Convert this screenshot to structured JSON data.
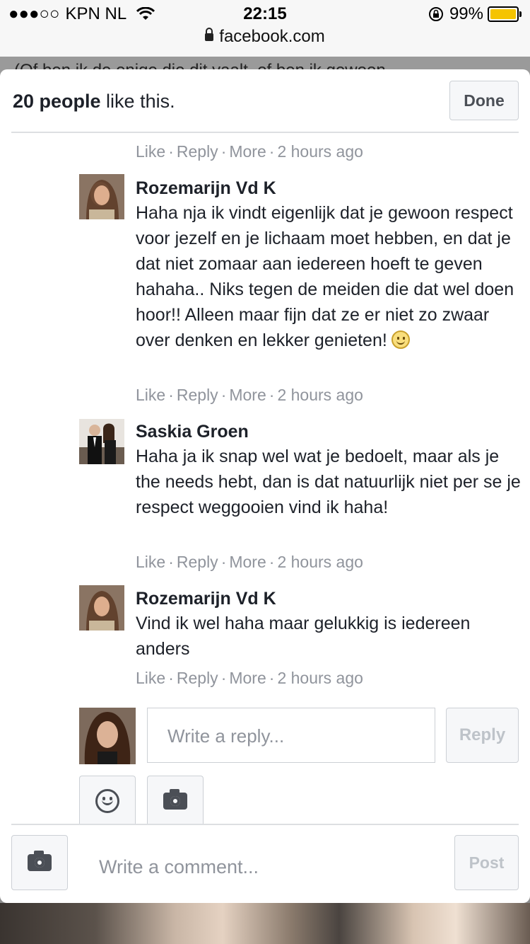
{
  "status_bar": {
    "signal": "●●●○○",
    "carrier": "KPN NL",
    "time": "22:15",
    "battery_percent": "99%",
    "battery_level": 0.99,
    "battery_color": "#f5c400"
  },
  "url_bar": {
    "domain": "facebook.com"
  },
  "background_text": "(Of ben ik de enige die dit vaalt, of ben ik gewoon",
  "header": {
    "likes_count": "20 people",
    "likes_suffix": " like this.",
    "done_label": "Done"
  },
  "top_meta": {
    "like": "Like",
    "reply": "Reply",
    "more": "More",
    "time": "2 hours ago"
  },
  "comments": [
    {
      "author": "Rozemarijn Vd K",
      "text": "Haha nja ik vindt eigenlijk dat je gewoon respect voor jezelf en je lichaam moet hebben, en dat je dat niet zomaar aan iedereen hoeft te geven hahaha.. Niks tegen de meiden die dat wel doen hoor!! Alleen maar fijn dat ze er niet zo zwaar over denken en lekker genieten!",
      "emoji": "smiley-emoji",
      "like": "Like",
      "reply": "Reply",
      "more": "More",
      "time": "2 hours ago"
    },
    {
      "author": "Saskia Groen",
      "text": "Haha ja ik snap wel wat je bedoelt, maar als je the needs hebt, dan is dat natuurlijk niet per se je respect weggooien vind ik haha!",
      "like": "Like",
      "reply": "Reply",
      "more": "More",
      "time": "2 hours ago"
    },
    {
      "author": "Rozemarijn Vd K",
      "text": "Vind ik wel haha maar gelukkig is iedereen anders",
      "like": "Like",
      "reply": "Reply",
      "more": "More",
      "time": "2 hours ago"
    }
  ],
  "reply_composer": {
    "placeholder": "Write a reply...",
    "reply_label": "Reply",
    "icons": [
      "emoji-icon",
      "camera-icon"
    ]
  },
  "comment_composer": {
    "placeholder": "Write a comment...",
    "post_label": "Post",
    "icon": "camera-icon"
  },
  "colors": {
    "meta_text": "#90949c",
    "primary_text": "#1d2129",
    "disabled_button_text": "#bec3c9"
  }
}
